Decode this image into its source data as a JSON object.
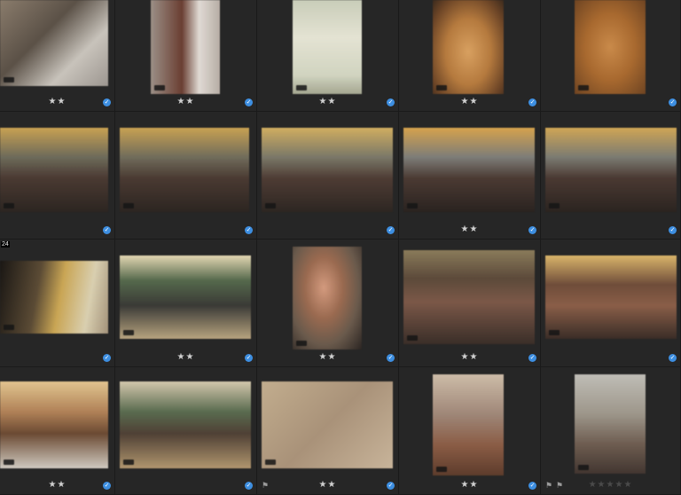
{
  "cells": [
    {
      "stars": "★★",
      "checked": true,
      "flags": 0,
      "image": "street-crowd",
      "bg": "linear-gradient(135deg,#8a7c6c 0%,#5b5147 40%,#c8c3bb 70%,#9c9690 100%)"
    },
    {
      "stars": "★★",
      "checked": true,
      "flags": 0,
      "image": "street-alley",
      "bg": "linear-gradient(90deg,#9b8f86 0%,#6a3e32 45%,#e0dad3 70%,#b7aea6 100%)"
    },
    {
      "stars": "★★",
      "checked": true,
      "flags": 0,
      "image": "menu-document",
      "bg": "linear-gradient(180deg,#c9cdb9 0%,#e4e3d3 40%,#d1d4c0 80%,#a4a690 100%)"
    },
    {
      "stars": "★★",
      "checked": true,
      "flags": 0,
      "image": "christmas-tree",
      "bg": "radial-gradient(ellipse at 50% 55%,#d8a060 0%,#b57a3e 45%,#6b4426 80%,#3b2a1d 100%)"
    },
    {
      "stars": "",
      "checked": true,
      "flags": 0,
      "image": "christmas-ornaments",
      "bg": "radial-gradient(ellipse at 50% 50%,#c98a4a 0%,#a8692f 50%,#6e4422 100%)"
    },
    {
      "stars": "",
      "checked": true,
      "flags": 0,
      "image": "classroom-group",
      "bg": "linear-gradient(180deg,#c8a152 0%,#6d6a5a 35%,#4a3a32 60%,#2c2521 100%)"
    },
    {
      "stars": "",
      "checked": true,
      "flags": 0,
      "image": "classroom-group",
      "bg": "linear-gradient(180deg,#c8a152 0%,#706c5b 35%,#4a3a32 60%,#2c2521 100%)"
    },
    {
      "stars": "",
      "checked": true,
      "flags": 0,
      "image": "classroom-group",
      "bg": "linear-gradient(180deg,#d0ad60 0%,#7a7868 35%,#4e3c34 60%,#2d2622 100%)"
    },
    {
      "stars": "★★",
      "checked": true,
      "flags": 0,
      "image": "classroom-group",
      "bg": "linear-gradient(180deg,#d5a24d 0%,#7d7d78 35%,#4b3a33 60%,#2a2320 100%)"
    },
    {
      "stars": "",
      "checked": true,
      "flags": 0,
      "image": "classroom-group",
      "bg": "linear-gradient(180deg,#cfa555 0%,#7b7b72 35%,#4a3932 60%,#2b2420 100%)"
    },
    {
      "stars": "",
      "checked": true,
      "flags": 0,
      "image": "hallway-blur",
      "label": "24",
      "bg": "linear-gradient(100deg,#1a1714 0%,#5b4b35 35%,#c9a554 55%,#d9cfb0 80%,#a3927a 100%)"
    },
    {
      "stars": "★★",
      "checked": true,
      "flags": 0,
      "image": "two-men-table",
      "bg": "linear-gradient(180deg,#e2d6b2 0%,#55694c 30%,#3a3a36 60%,#b7a37f 100%)"
    },
    {
      "stars": "★★",
      "checked": true,
      "flags": 0,
      "image": "portrait-man",
      "bg": "radial-gradient(ellipse at 45% 40%,#d39a7e 0%,#9a6a50 35%,#6a5a4c 65%,#2b2522 100%)"
    },
    {
      "stars": "★★",
      "checked": true,
      "flags": 0,
      "image": "group-photo",
      "bg": "linear-gradient(180deg,#8a7b5a 0%,#5c4a3a 30%,#7b5848 55%,#3a2e28 100%)"
    },
    {
      "stars": "",
      "checked": true,
      "flags": 0,
      "image": "group-photo",
      "bg": "linear-gradient(180deg,#d9b46a 0%,#6f4d3a 35%,#8a5e48 60%,#3a2d27 100%)"
    },
    {
      "stars": "★★",
      "checked": true,
      "flags": 0,
      "image": "dinner-table",
      "bg": "linear-gradient(180deg,#e1c48f 0%,#b08157 35%,#6b4a33 60%,#cfc9bf 100%)"
    },
    {
      "stars": "",
      "checked": true,
      "flags": 0,
      "image": "man-dinner",
      "bg": "linear-gradient(180deg,#d3c7ac 0%,#596b4f 35%,#4f4035 60%,#b0966e 100%)"
    },
    {
      "stars": "★★",
      "checked": true,
      "flags": 1,
      "image": "paper-texture",
      "bg": "linear-gradient(135deg,#c2ad8e 0%,#a99279 50%,#c8b49a 100%)"
    },
    {
      "stars": "★★",
      "checked": true,
      "flags": 0,
      "image": "table-food",
      "bg": "linear-gradient(180deg,#cdbca8 0%,#9e8677 40%,#8a5c45 70%,#5d3c2c 100%)"
    },
    {
      "stars": "★★★★★",
      "dim": true,
      "checked": false,
      "flags": 2,
      "image": "room-light",
      "bg": "linear-gradient(180deg,#bfbdb6 0%,#9d968a 40%,#6e5d51 70%,#423630 100%)"
    }
  ]
}
